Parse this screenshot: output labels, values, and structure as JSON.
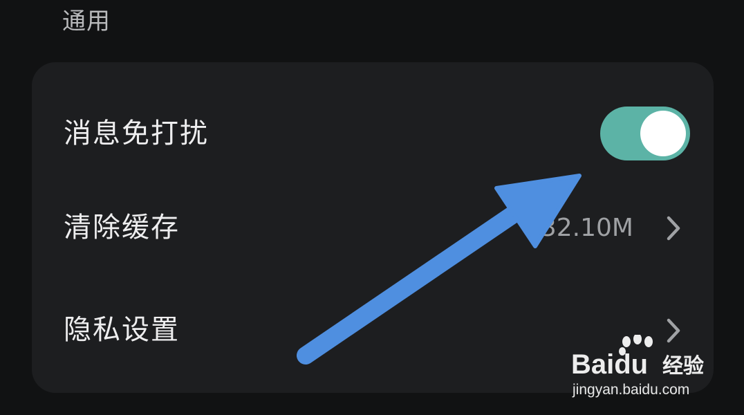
{
  "section": {
    "title": "通用"
  },
  "settings": {
    "rows": [
      {
        "label": "消息免打扰",
        "control": "toggle",
        "toggle_on": true
      },
      {
        "label": "清除缓存",
        "value": "32.10M",
        "control": "chevron"
      },
      {
        "label": "隐私设置",
        "control": "chevron"
      }
    ]
  },
  "colors": {
    "background": "#111213",
    "card": "#1d1e20",
    "toggle_track_on": "#5cb3a6",
    "annotation_arrow": "#4f8fe0"
  },
  "icons": {
    "chevron": "chevron-right-icon",
    "annotation": "arrow-annotation"
  },
  "watermark": {
    "logo_text": "Bai",
    "logo_text_2": "du",
    "brand_cn": "经验",
    "url": "jingyan.baidu.com"
  }
}
